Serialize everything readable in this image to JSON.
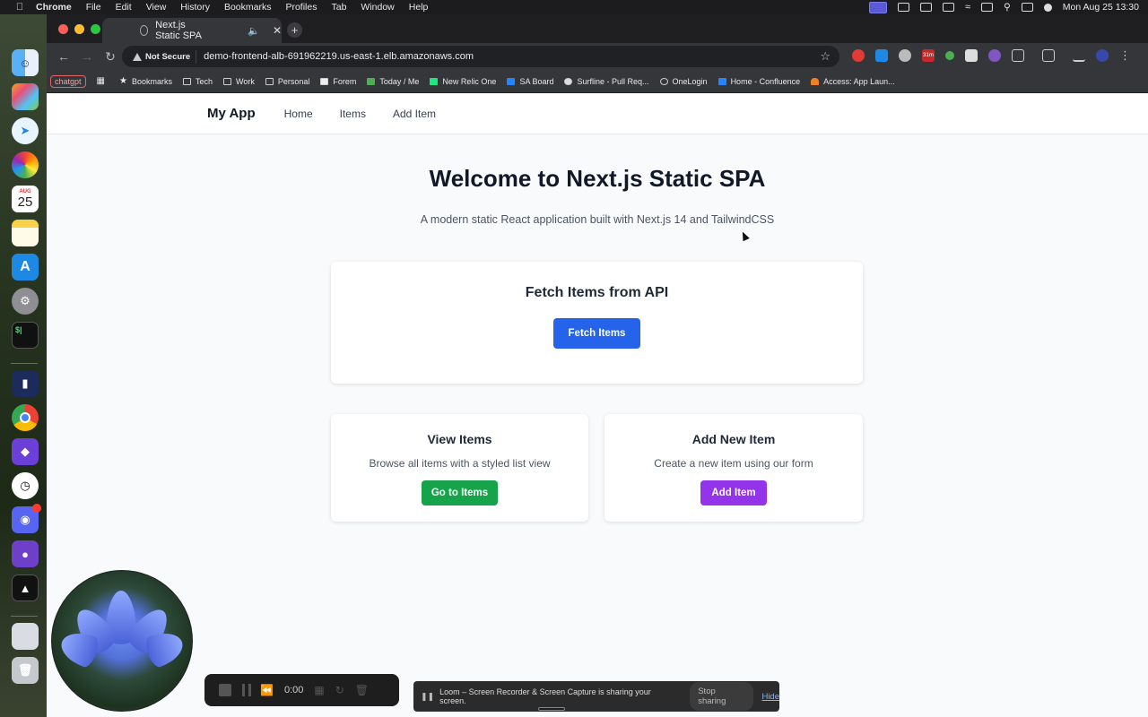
{
  "menubar": {
    "app": "Chrome",
    "items": [
      "File",
      "Edit",
      "View",
      "History",
      "Bookmarks",
      "Profiles",
      "Tab",
      "Window",
      "Help"
    ],
    "clock": "Mon Aug 25  13:30"
  },
  "dock": {
    "calendar_month": "AUG",
    "calendar_day": "25"
  },
  "browser": {
    "tab_title": "Next.js Static SPA",
    "security_label": "Not Secure",
    "url": "demo-frontend-alb-691962219.us-east-1.elb.amazonaws.com",
    "extension_badge": "31m",
    "bookmarks": {
      "chip": "chatgpt",
      "items": [
        "Bookmarks",
        "Tech",
        "Work",
        "Personal",
        "Forem",
        "Today / Me",
        "New Relic One",
        "SA Board",
        "Surfline - Pull Req...",
        "OneLogin",
        "Home - Confluence",
        "Access: App Laun..."
      ]
    }
  },
  "app": {
    "brand": "My App",
    "nav": [
      "Home",
      "Items",
      "Add Item"
    ],
    "hero_title": "Welcome to Next.js Static SPA",
    "hero_subtitle": "A modern static React application built with Next.js 14 and TailwindCSS",
    "fetch_card": {
      "title": "Fetch Items from API",
      "button": "Fetch Items",
      "button_color": "#2563eb"
    },
    "view_card": {
      "title": "View Items",
      "description": "Browse all items with a styled list view",
      "button": "Go to Items",
      "button_color": "#16a34a"
    },
    "add_card": {
      "title": "Add New Item",
      "description": "Create a new item using our form",
      "button": "Add Item",
      "button_color": "#9333ea"
    }
  },
  "loom": {
    "timer": "0:00",
    "share_text": "Loom – Screen Recorder & Screen Capture is sharing your screen.",
    "stop_label": "Stop sharing",
    "hide_label": "Hide"
  }
}
